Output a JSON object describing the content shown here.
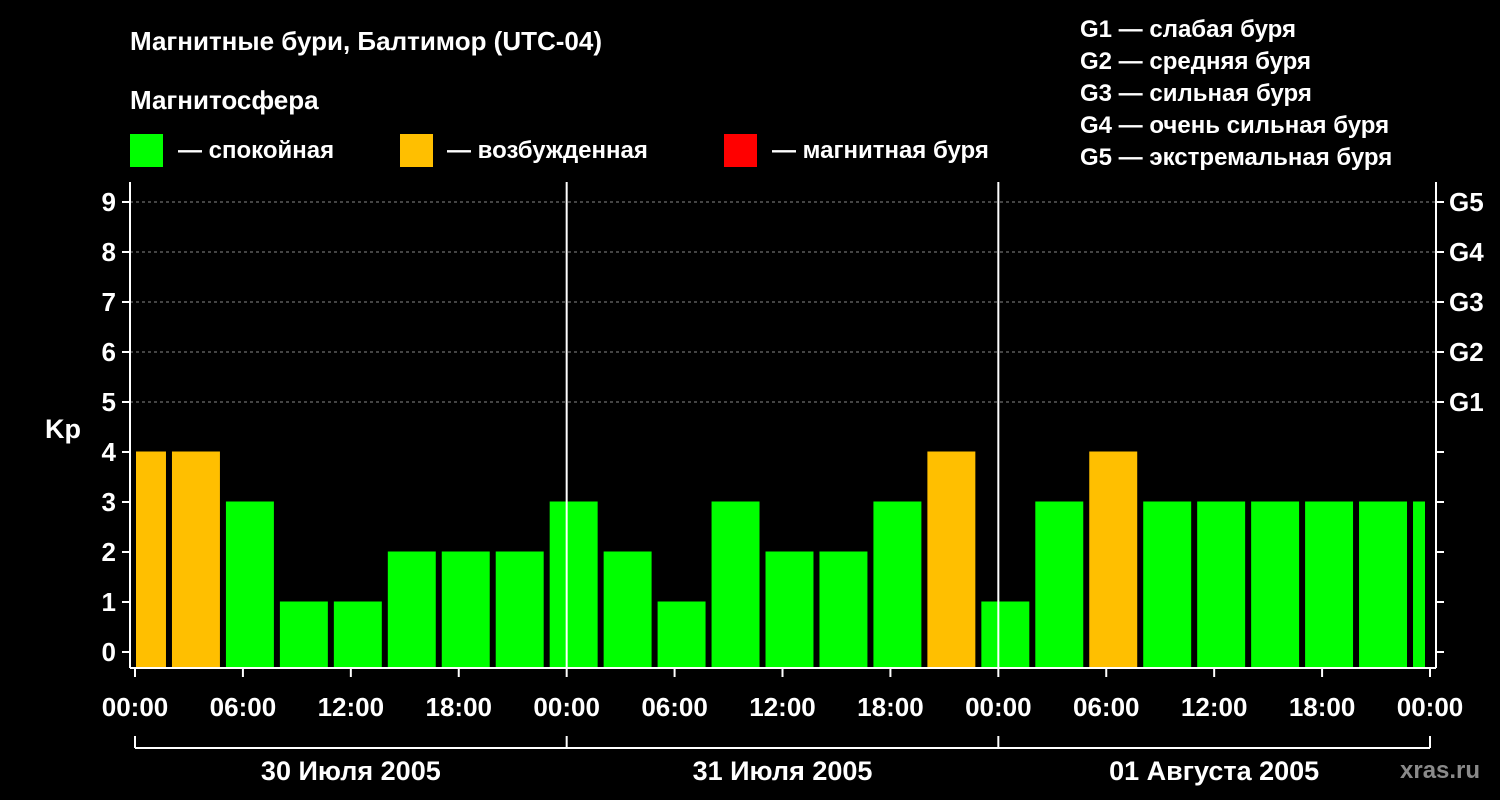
{
  "chart_data": {
    "type": "bar",
    "title": "Магнитные бури, Балтимор (UTC-04)",
    "legend_title": "Магнитосфера",
    "legend": [
      {
        "label": "— спокойная",
        "color": "#00ff00"
      },
      {
        "label": "— возбужденная",
        "color": "#ffbf00"
      },
      {
        "label": "— магнитная буря",
        "color": "#ff0000"
      }
    ],
    "storm_scale": [
      "G1 — слабая буря",
      "G2 — средняя буря",
      "G3 — сильная буря",
      "G4 — очень сильная буря",
      "G5 — экстремальная буря"
    ],
    "ylabel": "Kp",
    "ylim": [
      0,
      9
    ],
    "yticks": [
      0,
      1,
      2,
      3,
      4,
      5,
      6,
      7,
      8,
      9
    ],
    "right_ticks": [
      {
        "value": 5,
        "label": "G1"
      },
      {
        "value": 6,
        "label": "G2"
      },
      {
        "value": 7,
        "label": "G3"
      },
      {
        "value": 8,
        "label": "G4"
      },
      {
        "value": 9,
        "label": "G5"
      }
    ],
    "grid": true,
    "x_time_labels": [
      "00:00",
      "06:00",
      "12:00",
      "18:00",
      "00:00",
      "06:00",
      "12:00",
      "18:00",
      "00:00",
      "06:00",
      "12:00",
      "18:00",
      "00:00"
    ],
    "days": [
      "30 Июля 2005",
      "31 Июля 2005",
      "01 Августа 2005"
    ],
    "bars": [
      {
        "start": "2005-07-30 00:00",
        "end": "2005-07-30 02:00",
        "kp": 4,
        "state": "возбужденная"
      },
      {
        "start": "2005-07-30 02:00",
        "end": "2005-07-30 05:00",
        "kp": 4,
        "state": "возбужденная"
      },
      {
        "start": "2005-07-30 05:00",
        "end": "2005-07-30 08:00",
        "kp": 3,
        "state": "спокойная"
      },
      {
        "start": "2005-07-30 08:00",
        "end": "2005-07-30 11:00",
        "kp": 1,
        "state": "спокойная"
      },
      {
        "start": "2005-07-30 11:00",
        "end": "2005-07-30 14:00",
        "kp": 1,
        "state": "спокойная"
      },
      {
        "start": "2005-07-30 14:00",
        "end": "2005-07-30 17:00",
        "kp": 2,
        "state": "спокойная"
      },
      {
        "start": "2005-07-30 17:00",
        "end": "2005-07-30 20:00",
        "kp": 2,
        "state": "спокойная"
      },
      {
        "start": "2005-07-30 20:00",
        "end": "2005-07-30 23:00",
        "kp": 2,
        "state": "спокойная"
      },
      {
        "start": "2005-07-30 23:00",
        "end": "2005-07-31 02:00",
        "kp": 3,
        "state": "спокойная"
      },
      {
        "start": "2005-07-31 02:00",
        "end": "2005-07-31 05:00",
        "kp": 2,
        "state": "спокойная"
      },
      {
        "start": "2005-07-31 05:00",
        "end": "2005-07-31 08:00",
        "kp": 1,
        "state": "спокойная"
      },
      {
        "start": "2005-07-31 08:00",
        "end": "2005-07-31 11:00",
        "kp": 3,
        "state": "спокойная"
      },
      {
        "start": "2005-07-31 11:00",
        "end": "2005-07-31 14:00",
        "kp": 2,
        "state": "спокойная"
      },
      {
        "start": "2005-07-31 14:00",
        "end": "2005-07-31 17:00",
        "kp": 2,
        "state": "спокойная"
      },
      {
        "start": "2005-07-31 17:00",
        "end": "2005-07-31 20:00",
        "kp": 3,
        "state": "спокойная"
      },
      {
        "start": "2005-07-31 20:00",
        "end": "2005-07-31 23:00",
        "kp": 4,
        "state": "возбужденная"
      },
      {
        "start": "2005-07-31 23:00",
        "end": "2005-08-01 02:00",
        "kp": 1,
        "state": "спокойная"
      },
      {
        "start": "2005-08-01 02:00",
        "end": "2005-08-01 05:00",
        "kp": 3,
        "state": "спокойная"
      },
      {
        "start": "2005-08-01 05:00",
        "end": "2005-08-01 08:00",
        "kp": 4,
        "state": "возбужденная"
      },
      {
        "start": "2005-08-01 08:00",
        "end": "2005-08-01 11:00",
        "kp": 3,
        "state": "спокойная"
      },
      {
        "start": "2005-08-01 11:00",
        "end": "2005-08-01 14:00",
        "kp": 3,
        "state": "спокойная"
      },
      {
        "start": "2005-08-01 14:00",
        "end": "2005-08-01 17:00",
        "kp": 3,
        "state": "спокойная"
      },
      {
        "start": "2005-08-01 17:00",
        "end": "2005-08-01 20:00",
        "kp": 3,
        "state": "спокойная"
      },
      {
        "start": "2005-08-01 20:00",
        "end": "2005-08-01 23:00",
        "kp": 3,
        "state": "спокойная"
      },
      {
        "start": "2005-08-01 23:00",
        "end": "2005-08-02 00:00",
        "kp": 3,
        "state": "спокойная"
      }
    ],
    "colors": {
      "спокойная": "#00ff00",
      "возбужденная": "#ffbf00",
      "магнитная буря": "#ff0000",
      "background": "#000000",
      "axis": "#ffffff",
      "grid": "#888888"
    }
  },
  "watermark": "xras.ru"
}
